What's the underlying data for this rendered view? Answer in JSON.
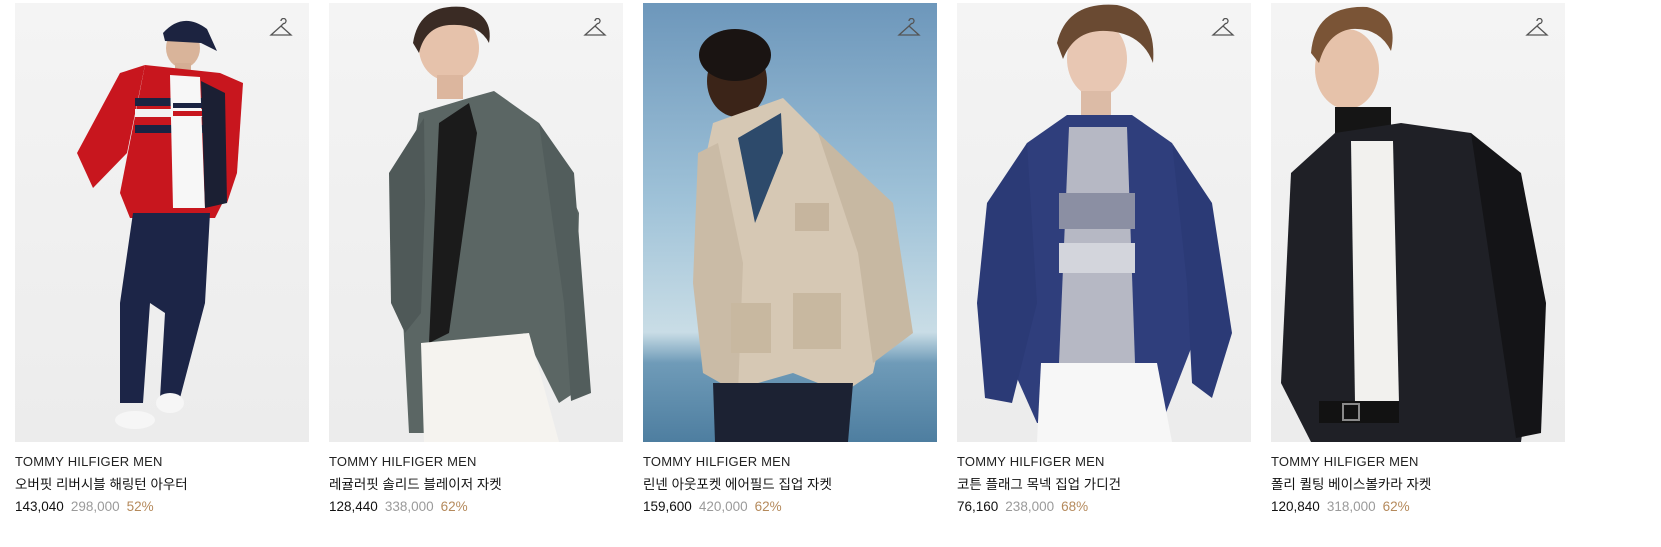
{
  "products": [
    {
      "brand": "TOMMY HILFIGER MEN",
      "name": "오버핏 리버시블 해링턴 아우터",
      "price": "143,040",
      "original_price": "298,000",
      "discount": "52%"
    },
    {
      "brand": "TOMMY HILFIGER MEN",
      "name": "레귤러핏 솔리드 블레이저 자켓",
      "price": "128,440",
      "original_price": "338,000",
      "discount": "62%"
    },
    {
      "brand": "TOMMY HILFIGER MEN",
      "name": "린넨 아웃포켓 에어필드 집업 자켓",
      "price": "159,600",
      "original_price": "420,000",
      "discount": "62%"
    },
    {
      "brand": "TOMMY HILFIGER MEN",
      "name": "코튼 플래그 목넥 집업 가디건",
      "price": "76,160",
      "original_price": "238,000",
      "discount": "68%"
    },
    {
      "brand": "TOMMY HILFIGER MEN",
      "name": "폴리 퀼팅 베이스볼카라 자켓",
      "price": "120,840",
      "original_price": "318,000",
      "discount": "62%"
    }
  ],
  "icons": {
    "wishlist": "hanger-icon"
  },
  "colors": {
    "discount": "#b58a5c",
    "original_price": "#9a9a9a",
    "text": "#111111"
  }
}
